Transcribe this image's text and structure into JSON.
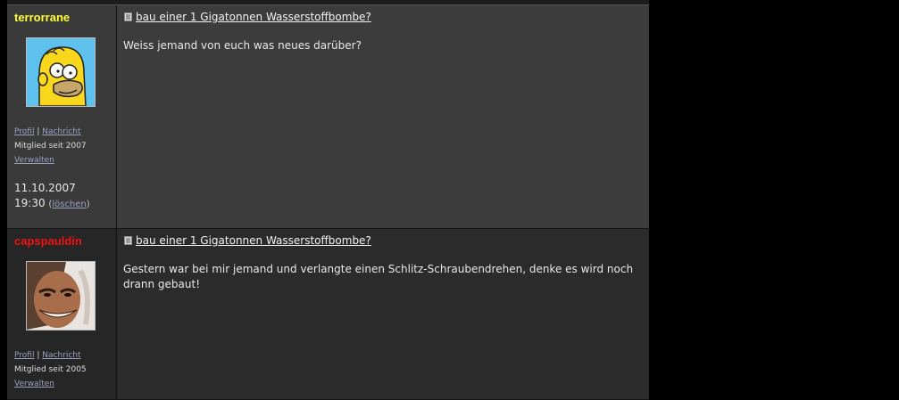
{
  "posts": [
    {
      "username": "terrorrane",
      "username_color": "#ffff33",
      "profile_label": "Profil",
      "message_label": "Nachricht",
      "member_since": "Mitglied seit 2007",
      "manage_label": "Verwalten",
      "date": "11.10.2007",
      "time": "19:30",
      "delete_label": "löschen",
      "title": "bau einer 1 Gigatonnen Wasserstoffbombe?",
      "body": "Weiss jemand von euch was neues darüber?"
    },
    {
      "username": "capspauldin",
      "username_color": "#ee1111",
      "profile_label": "Profil",
      "message_label": "Nachricht",
      "member_since": "Mitglied seit 2005",
      "manage_label": "Verwalten",
      "title": "bau einer 1 Gigatonnen Wasserstoffbombe?",
      "body": "Gestern war bei mir jemand und verlangte einen Schlitz-Schraubendrehen, denke es wird noch\ndrann gebaut!"
    }
  ]
}
